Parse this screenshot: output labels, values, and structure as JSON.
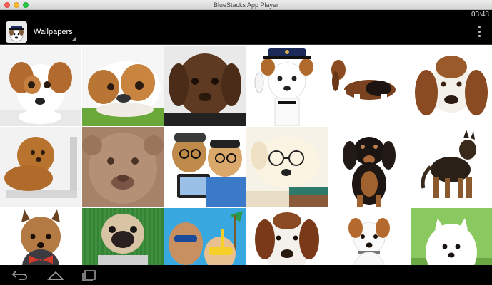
{
  "window": {
    "title": "BlueStacks App Player"
  },
  "status_bar": {
    "time": "03:48"
  },
  "app_bar": {
    "title": "Wallpapers",
    "menu_icon": "more-vert-icon"
  },
  "grid": {
    "tiles": [
      {
        "subject": "jack-russell-puppy-photo"
      },
      {
        "subject": "bulldog-on-grass-photo"
      },
      {
        "subject": "brown-labrador-puppy-photo"
      },
      {
        "subject": "jack-russell-police-hat-photo"
      },
      {
        "subject": "basset-hound-standing-photo"
      },
      {
        "subject": "basset-hound-lying-photo"
      },
      {
        "subject": "poodle-on-laptop-photo"
      },
      {
        "subject": "pitbull-closeup-photo"
      },
      {
        "subject": "dogs-selfie-glasses-photo"
      },
      {
        "subject": "labrador-glasses-books-photo"
      },
      {
        "subject": "dachshund-sitting-photo"
      },
      {
        "subject": "german-shepherd-standing-photo"
      },
      {
        "subject": "yorkshire-terrier-photo"
      },
      {
        "subject": "pug-on-grass-photo"
      },
      {
        "subject": "dogs-beach-goggles-photo"
      },
      {
        "subject": "saint-bernard-puppy-photo"
      },
      {
        "subject": "jack-russell-sitting-photo"
      },
      {
        "subject": "white-pomeranian-photo"
      }
    ]
  },
  "nav_bar": {
    "back": "back-icon",
    "home": "home-icon",
    "recents": "recents-icon"
  }
}
